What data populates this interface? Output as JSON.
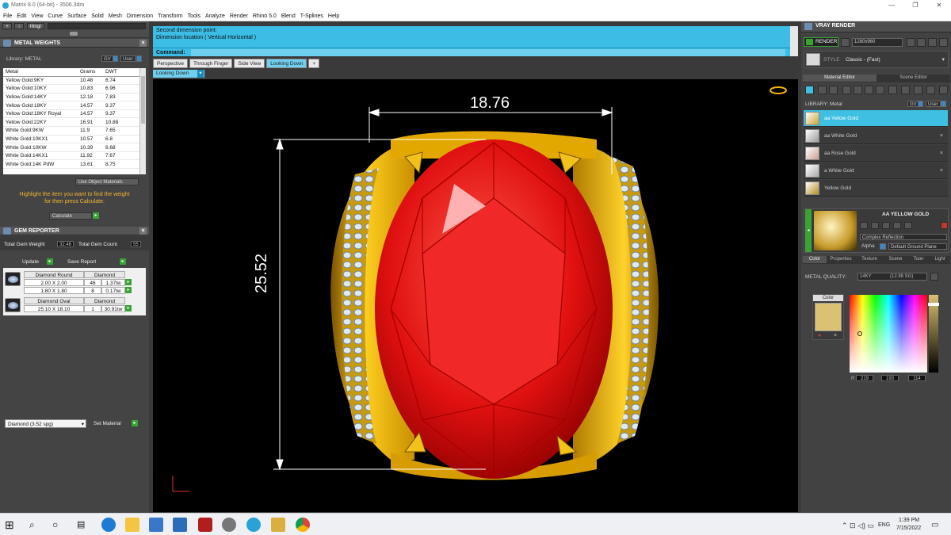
{
  "window": {
    "title": "Matrix 8.0 (64-bit) - 3506.3dm"
  },
  "menu": [
    "File",
    "Edit",
    "View",
    "Curve",
    "Surface",
    "Solid",
    "Mesh",
    "Dimension",
    "Transform",
    "Tools",
    "Analyze",
    "Render",
    "Rhino 5.0",
    "Blend",
    "T-Splines",
    "Help"
  ],
  "left_toolbar": {
    "up_label": "+",
    "hingr": "Hingr"
  },
  "metal_weights": {
    "title": "METAL WEIGHTS",
    "library_label": "Library: METAL",
    "gv_label": "GV",
    "user_label": "User",
    "columns": [
      "Metal",
      "Grams",
      "DWT"
    ],
    "rows": [
      [
        "Yellow Gold:9KY",
        "10.48",
        "6.74"
      ],
      [
        "Yellow Gold:10KY",
        "10.83",
        "6.96"
      ],
      [
        "Yellow Gold:14KY",
        "12.18",
        "7.83"
      ],
      [
        "Yellow Gold:18KY",
        "14.57",
        "9.37"
      ],
      [
        "Yellow Gold:18KY Royal",
        "14.57",
        "9.37"
      ],
      [
        "Yellow Gold:22KY",
        "16.91",
        "10.88"
      ],
      [
        "White Gold:9KW",
        "11.9",
        "7.65"
      ],
      [
        "White Gold:10KX1",
        "10.57",
        "6.8"
      ],
      [
        "White Gold:10KW",
        "10.39",
        "6.68"
      ],
      [
        "White Gold:14KX1",
        "11.92",
        "7.67"
      ],
      [
        "White Gold:14K PdW",
        "13.61",
        "8.75"
      ]
    ],
    "use_object_materials": "Use Object Materials",
    "hint_line1": "Highlight the item you want to find the weight",
    "hint_line2": "for then press Calculate.",
    "calculate": "Calculate"
  },
  "gem_reporter": {
    "title": "GEM REPORTER",
    "total_weight_label": "Total Gem Weight",
    "total_weight": "32.46",
    "total_count_label": "Total Gem Count",
    "total_count": "55",
    "update": "Update",
    "save_report": "Save Report",
    "groups": [
      {
        "name": "Diamond Round",
        "material": "Diamond",
        "rows": [
          [
            "2.00 X 2.00",
            "46",
            "1.37tw"
          ],
          [
            "1.80 X 1.80",
            "8",
            "0.17tw"
          ]
        ]
      },
      {
        "name": "Diamond Oval",
        "material": "Diamond",
        "rows": [
          [
            "25.10 X 18.10",
            "1",
            "30.91tw"
          ]
        ]
      }
    ],
    "material_select": "Diamond    (3.52 spg)",
    "set_material": "Set Material"
  },
  "command": {
    "line1": "Second dimension point:",
    "line2": "Dimension location ( Vertical  Horizontal )",
    "prompt": "Command:"
  },
  "view_tabs": [
    "Perspective",
    "Through Finger",
    "Side View",
    "Looking Down"
  ],
  "active_view": "Looking Down",
  "viewport": {
    "dim_horizontal": "18.76",
    "dim_vertical": "25.52"
  },
  "vray": {
    "title": "VRAY RENDER",
    "render": "RENDER",
    "resolution": "1280x960",
    "style_label": "STYLE",
    "style_value": "Classic - (Fast)",
    "tabs": [
      "Material Editor",
      "Scene Editor"
    ],
    "library_label": "LIBRARY: Metal",
    "gv_label": "GV",
    "user_label": "User",
    "materials": [
      "aa Yellow Gold",
      "aa White Gold",
      "aa Rose Gold",
      "a White Gold",
      "Yellow Gold"
    ],
    "preview_title": "AA YELLOW GOLD",
    "reflection": "Complex Reflection",
    "alpha_label": "Alpha",
    "ground": "Default Ground Plane",
    "prop_tabs": [
      "Color",
      "Properties",
      "Texture",
      "Scene",
      "Toon",
      "Light"
    ],
    "metal_quality_label": "METAL QUALITY:",
    "metal_quality": "14KY",
    "metal_sg": "(12.98 SG)",
    "color_label": "Color",
    "rgb": [
      "219",
      "193",
      "114"
    ],
    "swatch": "#dbc172"
  },
  "taskbar": {
    "lang": "ENG",
    "time": "1:39 PM",
    "date": "7/15/2022"
  }
}
